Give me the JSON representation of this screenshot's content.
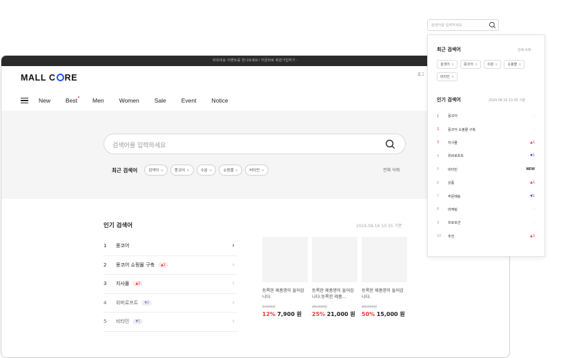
{
  "topbar": {
    "text": "비유비승 이벤트를 만나보세요! 지금바로 회원가입하기 -"
  },
  "header": {
    "login": "로그"
  },
  "nav": {
    "items": [
      "New",
      "Best",
      "Men",
      "Women",
      "Sale",
      "Event",
      "Notice"
    ]
  },
  "search": {
    "placeholder": "검색어를 입력하세요"
  },
  "recent": {
    "label": "최근 검색어",
    "chips": [
      "검색어",
      "몽코어",
      "수분",
      "쇼핑몰",
      "비타민"
    ],
    "clear": "전체 삭제"
  },
  "popular": {
    "title": "인기 검색어",
    "date": "2024.08.16 10:35 기준",
    "rows": [
      {
        "num": "1",
        "kw": "몽코어",
        "badge": ""
      },
      {
        "num": "2",
        "kw": "몽코어 쇼핑몰 구축",
        "badge": "▲1"
      },
      {
        "num": "3",
        "kw": "지사몰",
        "badge": "▲2"
      },
      {
        "num": "4",
        "kw": "위버로프트",
        "badge": "▼2"
      },
      {
        "num": "5",
        "kw": "비타민",
        "badge": "▼1"
      }
    ]
  },
  "products": [
    {
      "name": "등록한 제품명이 들어갑니다.",
      "orig": "9,000원",
      "discount": "12%",
      "price": "7,900 원"
    },
    {
      "name": "등록한 제품명이 들어갑니다.등록한 제품...",
      "orig": "28,000원",
      "discount": "25%",
      "price": "21,000 원"
    },
    {
      "name": "등록한 제품명이 들어갑니다.",
      "orig": "30,000원",
      "discount": "50%",
      "price": "15,000 원"
    }
  ],
  "dropdown": {
    "search_placeholder": "검색어를 입력하세요",
    "recent_title": "최근 검색어",
    "recent_clear": "전체 삭제",
    "recent_chips": [
      "검색어",
      "몽코어",
      "수분",
      "쇼핑몰",
      "비타민"
    ],
    "popular_title": "인기 검색어",
    "popular_date": "2024.08.16 10:35 기준",
    "rows": [
      {
        "num": "1",
        "kw": "몽코어",
        "chg": "–",
        "kind": "same"
      },
      {
        "num": "2",
        "kw": "몽코어 쇼핑몰 구축",
        "chg": "–",
        "kind": "same"
      },
      {
        "num": "3",
        "kw": "지사몰",
        "chg": "▲1",
        "kind": "up"
      },
      {
        "num": "4",
        "kw": "위버로프트",
        "chg": "▼1",
        "kind": "down"
      },
      {
        "num": "5",
        "kw": "비타민",
        "chg": "NEW",
        "kind": "new"
      },
      {
        "num": "6",
        "kw": "상품",
        "chg": "▲1",
        "kind": "up"
      },
      {
        "num": "7",
        "kw": "주문배송",
        "chg": "▼1",
        "kind": "down"
      },
      {
        "num": "8",
        "kw": "마케팅",
        "chg": "–",
        "kind": "same"
      },
      {
        "num": "9",
        "kw": "프로모션",
        "chg": "–",
        "kind": "same"
      },
      {
        "num": "10",
        "kw": "추천",
        "chg": "▲3",
        "kind": "up"
      }
    ]
  },
  "colors": {
    "accent": "#1a56ff",
    "up": "#e63a3a",
    "down": "#2f56d9"
  }
}
